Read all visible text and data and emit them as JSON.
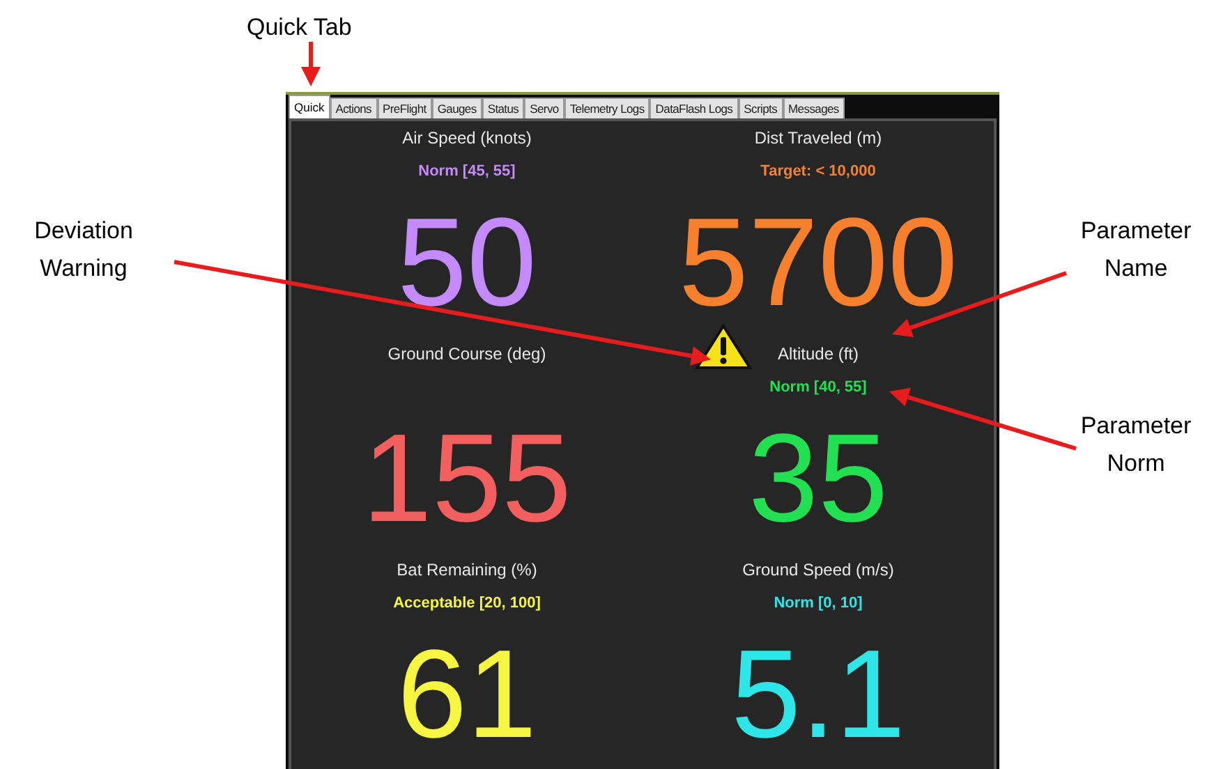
{
  "annotations": [
    {
      "text": "Quick Tab"
    },
    {
      "text": "Deviation Warning"
    },
    {
      "text": "Parameter Name"
    },
    {
      "text": "Parameter Norm"
    }
  ],
  "tabs": [
    {
      "label": "Quick",
      "selected": true
    },
    {
      "label": "Actions",
      "selected": false
    },
    {
      "label": "PreFlight",
      "selected": false
    },
    {
      "label": "Gauges",
      "selected": false
    },
    {
      "label": "Status",
      "selected": false
    },
    {
      "label": "Servo",
      "selected": false
    },
    {
      "label": "Telemetry Logs",
      "selected": false
    },
    {
      "label": "DataFlash Logs",
      "selected": false
    },
    {
      "label": "Scripts",
      "selected": false
    },
    {
      "label": "Messages",
      "selected": false
    }
  ],
  "gauges": [
    {
      "name": "Air Speed (knots)",
      "norm": "Norm [45, 55]",
      "value": "50",
      "color": "#c58af9",
      "warning": false
    },
    {
      "name": "Dist Traveled (m)",
      "norm": "Target: < 10,000",
      "value": "5700",
      "color": "#f7802f",
      "warning": false
    },
    {
      "name": "Ground Course (deg)",
      "value": "155",
      "color": "#f25f5f",
      "warning": false
    },
    {
      "name": "Altitude (ft)",
      "norm": "Norm [40, 55]",
      "value": "35",
      "color": "#22e052",
      "warning": true
    },
    {
      "name": "Bat Remaining (%)",
      "norm": "Acceptable [20, 100]",
      "value": "61",
      "color": "#f5f542",
      "warning": false
    },
    {
      "name": "Ground Speed (m/s)",
      "norm": "Norm [0, 10]",
      "value": "5.1",
      "color": "#2ee6e8",
      "warning": false
    }
  ]
}
